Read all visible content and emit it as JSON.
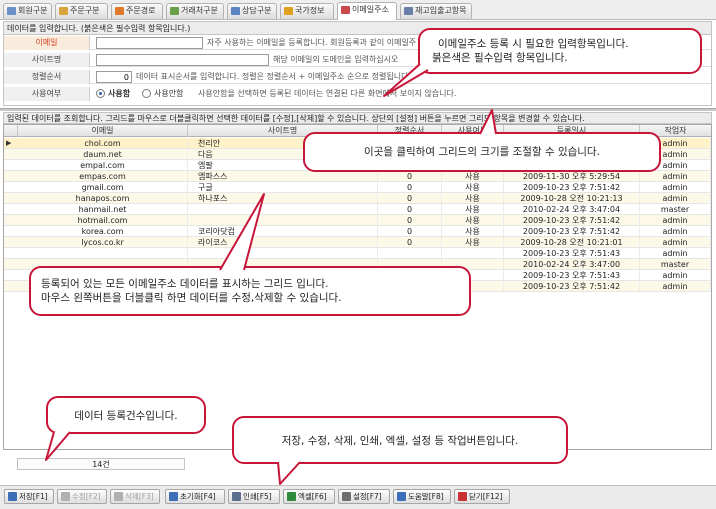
{
  "tabs": [
    {
      "label": "회원구분",
      "icon": "member-icon",
      "color": "#6a8fc9"
    },
    {
      "label": "주문구분",
      "icon": "order-icon",
      "color": "#d8a43b"
    },
    {
      "label": "주문경로",
      "icon": "route-icon",
      "color": "#e07a2a"
    },
    {
      "label": "거래처구분",
      "icon": "client-icon",
      "color": "#6aa04a"
    },
    {
      "label": "상담구분",
      "icon": "consult-icon",
      "color": "#5b84c4"
    },
    {
      "label": "국가정보",
      "icon": "globe-icon",
      "color": "#e0a020"
    },
    {
      "label": "이메일주소",
      "icon": "mail-icon",
      "color": "#c94a4a",
      "active": true
    },
    {
      "label": "재고입출고항목",
      "icon": "stock-icon",
      "color": "#6a7fa8"
    }
  ],
  "form": {
    "header": "데이터를 입력합니다. (붉은색은 필수입력 항목입니다.)",
    "email_label": "이메일",
    "email_value": "",
    "email_hint": "자주 사용하는 이메일을 등록합니다. 회원등록과 같이 이메일주",
    "site_label": "사이트명",
    "site_value": "",
    "site_hint": "해당 이메일의 도메인을 입력하십시오",
    "order_label": "정렬순서",
    "order_value": "0",
    "order_hint": "데이터 표시순서를 입력합니다. 정렬은 정렬순서 + 이메일주소 순으로 정렬됩니다.",
    "use_label": "사용여부",
    "use_on": "사용함",
    "use_off": "사용안함",
    "use_hint": "사용안함을 선택하면 등록된 데이터는 연결된 다른 화면에서 보이지 않습니다."
  },
  "grid": {
    "header": "입력된 데이터를 조회합니다. 그리드를 마우스로 더블클릭하면 선택한 데이터를 [수정],[삭제]할 수 있습니다. 상단의 [설정] 버튼을 누르면 그리드 항목을 변경할 수 있습니다.",
    "columns": [
      "이메일",
      "사이트명",
      "정렬순서",
      "사용여부",
      "등록일시",
      "작업자"
    ],
    "rows": [
      {
        "email": "chol.com",
        "site": "천리안",
        "order": "0",
        "use": "사용",
        "date": "2009-10-23 오후 7:51:42",
        "user": "admin"
      },
      {
        "email": "daum.net",
        "site": "다음",
        "order": "0",
        "use": "사용",
        "date": "2009-10-23 오후 7:51:42",
        "user": "admin"
      },
      {
        "email": "empal.com",
        "site": "엠팔",
        "order": "0",
        "use": "사용",
        "date": "2009-10-23 오후 7:51:42",
        "user": "admin"
      },
      {
        "email": "empas.com",
        "site": "엠파스스",
        "order": "0",
        "use": "사용",
        "date": "2009-11-30 오후 5:29:54",
        "user": "admin"
      },
      {
        "email": "gmail.com",
        "site": "구글",
        "order": "0",
        "use": "사용",
        "date": "2009-10-23 오후 7:51:42",
        "user": "admin"
      },
      {
        "email": "hanapos.com",
        "site": "하나포스",
        "order": "0",
        "use": "사용",
        "date": "2009-10-28 오전 10:21:13",
        "user": "admin"
      },
      {
        "email": "hanmail.net",
        "site": "",
        "order": "0",
        "use": "사용",
        "date": "2010-02-24 오후 3:47:04",
        "user": "master"
      },
      {
        "email": "hotmail.com",
        "site": "",
        "order": "0",
        "use": "사용",
        "date": "2009-10-23 오후 7:51:42",
        "user": "admin"
      },
      {
        "email": "korea.com",
        "site": "코리아닷컴",
        "order": "0",
        "use": "사용",
        "date": "2009-10-23 오후 7:51:42",
        "user": "admin"
      },
      {
        "email": "lycos.co.kr",
        "site": "라이코스",
        "order": "0",
        "use": "사용",
        "date": "2009-10-28 오전 10:21:01",
        "user": "admin"
      },
      {
        "email": "",
        "site": "",
        "order": "",
        "use": "",
        "date": "2009-10-23 오후 7:51:43",
        "user": "admin"
      },
      {
        "email": "",
        "site": "",
        "order": "",
        "use": "",
        "date": "2010-02-24 오후 3:47:00",
        "user": "master"
      },
      {
        "email": "",
        "site": "",
        "order": "",
        "use": "",
        "date": "2009-10-23 오후 7:51:43",
        "user": "admin"
      },
      {
        "email": "",
        "site": "",
        "order": "",
        "use": "",
        "date": "2009-10-23 오후 7:51:42",
        "user": "admin"
      }
    ]
  },
  "footer": {
    "count": "14건"
  },
  "toolbar": [
    {
      "label": "저장[F1]",
      "icon": "save-icon",
      "color": "#3d6fb8",
      "disabled": false
    },
    {
      "label": "수정[F2]",
      "icon": "edit-icon",
      "color": "#b0b0b0",
      "disabled": true
    },
    {
      "label": "삭제[F3]",
      "icon": "delete-icon",
      "color": "#b0b0b0",
      "disabled": true
    },
    {
      "label": "초기화[F4]",
      "icon": "reset-icon",
      "color": "#3d6fb8",
      "disabled": false
    },
    {
      "label": "인쇄[F5]",
      "icon": "print-icon",
      "color": "#5b6f8c",
      "disabled": false
    },
    {
      "label": "엑셀[F6]",
      "icon": "excel-icon",
      "color": "#2e8a3d",
      "disabled": false
    },
    {
      "label": "설정[F7]",
      "icon": "settings-icon",
      "color": "#6f6f6f",
      "disabled": false
    },
    {
      "label": "도움말[F8]",
      "icon": "help-icon",
      "color": "#3d6fb8",
      "disabled": false
    },
    {
      "label": "닫기[F12]",
      "icon": "close-icon",
      "color": "#c83232",
      "disabled": false
    }
  ],
  "callouts": {
    "input": "이메일주소 등록 시 필요한 입력항목입니다.",
    "input2": "붉은색은 필수입력 항목입니다.",
    "splitter": "이곳을 클릭하여 그리드의 크기를 조절할 수 있습니다.",
    "grid1": "등록되어 있는 모든 이메일주소 데이터를 표시하는 그리드 입니다.",
    "grid2": "마우스 왼쪽버튼을 더블클릭 하면 데이터를 수정,삭제할 수 있습니다.",
    "count": "데이터 등록건수입니다.",
    "toolbar": "저장, 수정, 삭제, 인쇄, 엑셀, 설정 등 작업버튼입니다."
  }
}
